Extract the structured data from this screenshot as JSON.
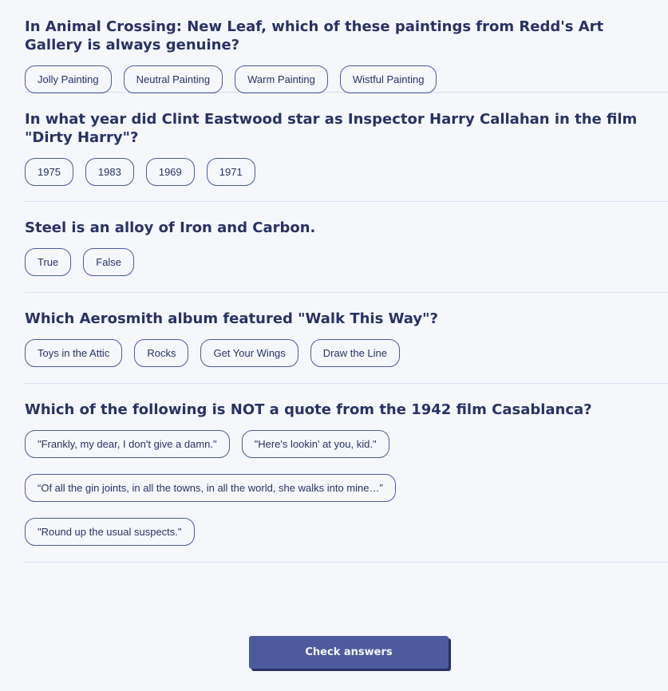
{
  "questions": [
    {
      "text": "In Animal Crossing: New Leaf, which of these paintings from Redd's Art Gallery is always genuine?",
      "answers": [
        "Jolly Painting",
        "Neutral Painting",
        "Warm Painting",
        "Wistful Painting"
      ]
    },
    {
      "text": "In what year did Clint Eastwood star as Inspector Harry Callahan in the film \"Dirty Harry\"?",
      "answers": [
        "1975",
        "1983",
        "1969",
        "1971"
      ]
    },
    {
      "text": "Steel is an alloy of Iron and Carbon.",
      "answers": [
        "True",
        "False"
      ]
    },
    {
      "text": "Which Aerosmith album featured \"Walk This Way\"?",
      "answers": [
        "Toys in the Attic",
        "Rocks",
        "Get Your Wings",
        "Draw the Line"
      ]
    },
    {
      "text": "Which of the following is NOT a quote from the 1942 film Casablanca?",
      "answers": [
        "\"Frankly, my dear, I don't give a damn.\"",
        "\"Here's lookin' at you, kid.\"",
        "“Of all the gin joints, in all the towns, in all the world, she walks into mine…”",
        "\"Round up the usual suspects.\""
      ]
    }
  ],
  "check_button_label": "Check answers",
  "colors": {
    "background": "#f5f7fb",
    "text": "#293264",
    "border": "#4d5b9e",
    "button": "#4d5b9e",
    "divider": "#dbdef0"
  }
}
